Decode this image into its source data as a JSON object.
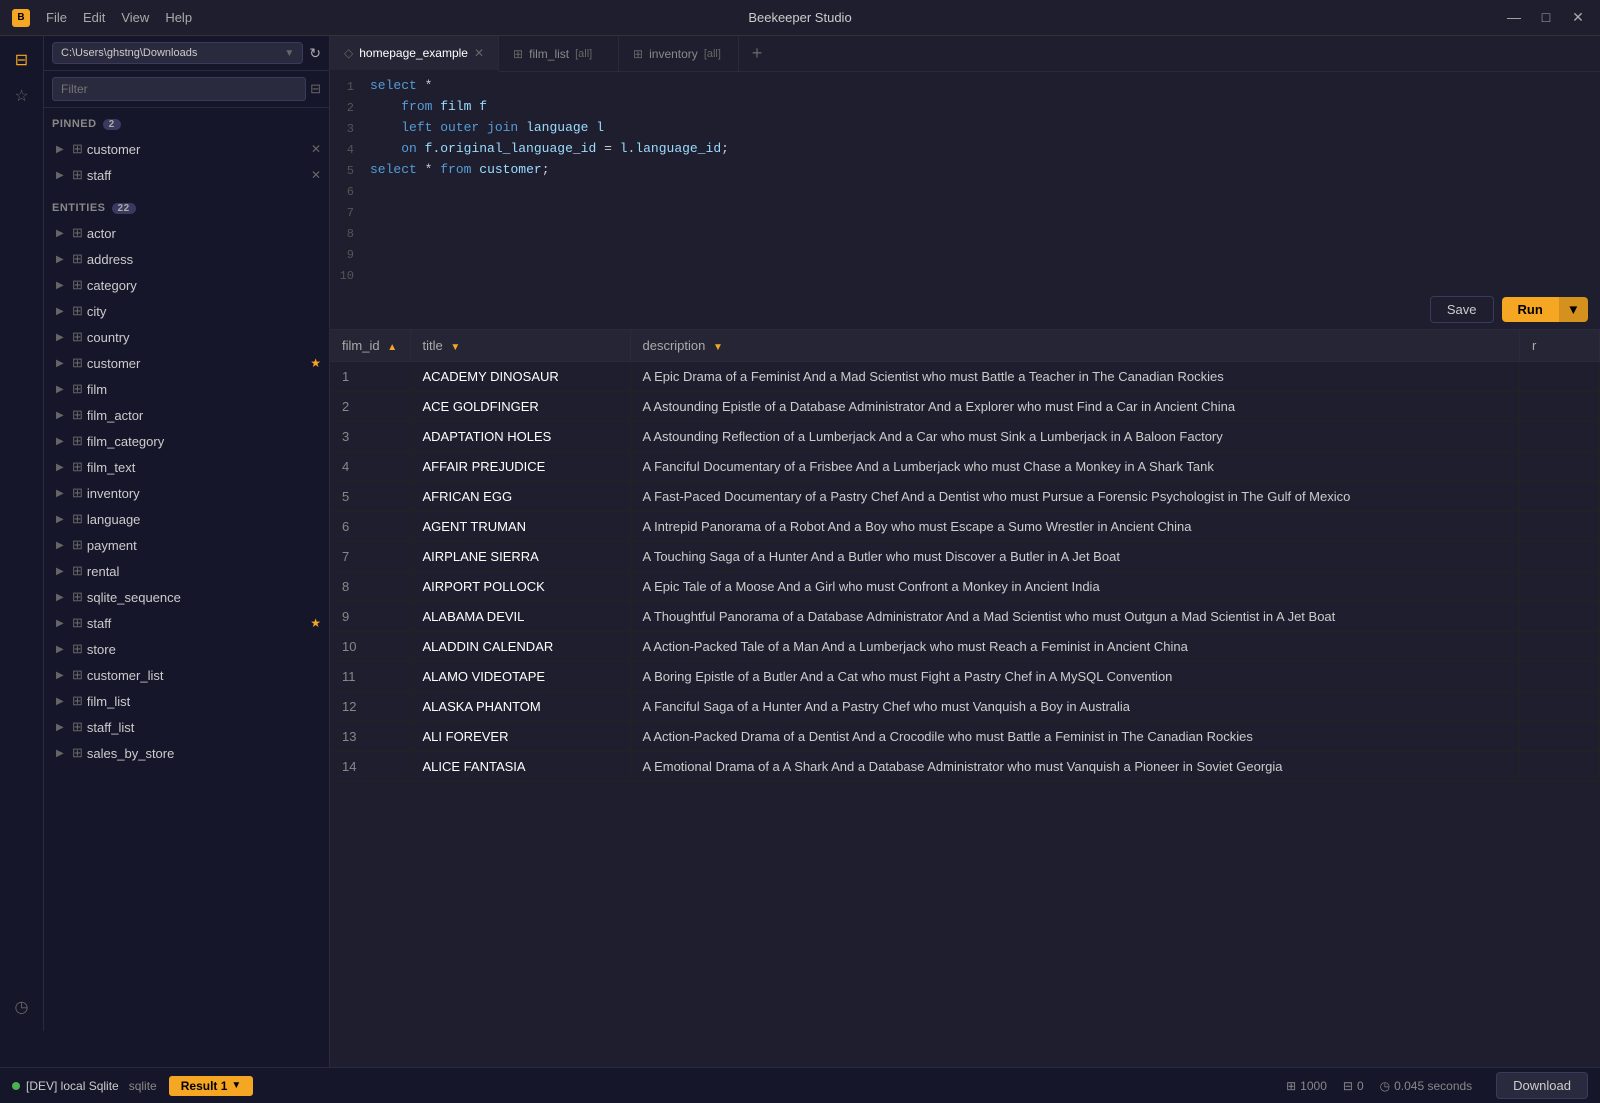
{
  "app": {
    "title": "Beekeeper Studio",
    "icon": "B"
  },
  "titlebar": {
    "menus": [
      "File",
      "Edit",
      "View",
      "Help"
    ],
    "controls": [
      "—",
      "□",
      "✕"
    ]
  },
  "sidebar": {
    "db_path": "C:\\Users\\ghstng\\Downloads",
    "filter_placeholder": "Filter",
    "pinned_section": "PINNED",
    "pinned_count": "2",
    "entities_section": "ENTITIES",
    "entities_count": "22",
    "pinned_items": [
      {
        "name": "customer",
        "pinned": false,
        "has_close": true
      },
      {
        "name": "staff",
        "pinned": false,
        "has_close": true
      }
    ],
    "entities": [
      {
        "name": "actor"
      },
      {
        "name": "address"
      },
      {
        "name": "category"
      },
      {
        "name": "city"
      },
      {
        "name": "country"
      },
      {
        "name": "customer",
        "starred": true
      },
      {
        "name": "film"
      },
      {
        "name": "film_actor"
      },
      {
        "name": "film_category"
      },
      {
        "name": "film_text"
      },
      {
        "name": "inventory"
      },
      {
        "name": "language"
      },
      {
        "name": "payment"
      },
      {
        "name": "rental"
      },
      {
        "name": "sqlite_sequence"
      },
      {
        "name": "staff",
        "starred": true
      },
      {
        "name": "store"
      },
      {
        "name": "customer_list"
      },
      {
        "name": "film_list"
      },
      {
        "name": "staff_list"
      },
      {
        "name": "sales_by_store"
      }
    ]
  },
  "tabs": [
    {
      "id": "homepage_example",
      "label": "homepage_example",
      "icon": "◇",
      "active": true,
      "closable": true
    },
    {
      "id": "film_list",
      "label": "film_list",
      "suffix": "[all]",
      "icon": "⊞",
      "active": false,
      "closable": false
    },
    {
      "id": "inventory",
      "label": "inventory",
      "suffix": "[all]",
      "icon": "⊞",
      "active": false,
      "closable": false
    }
  ],
  "editor": {
    "lines": [
      {
        "num": 1,
        "content": "select *"
      },
      {
        "num": 2,
        "content": "    from film f"
      },
      {
        "num": 3,
        "content": "    left outer join language l"
      },
      {
        "num": 4,
        "content": "    on f.original_language_id = l.language_id;"
      },
      {
        "num": 5,
        "content": "select * from customer;"
      },
      {
        "num": 6,
        "content": ""
      },
      {
        "num": 7,
        "content": ""
      },
      {
        "num": 8,
        "content": ""
      },
      {
        "num": 9,
        "content": ""
      },
      {
        "num": 10,
        "content": ""
      }
    ]
  },
  "toolbar": {
    "save_label": "Save",
    "run_label": "Run"
  },
  "table": {
    "columns": [
      {
        "id": "film_id",
        "label": "film_id",
        "sortable": true,
        "sort": "asc"
      },
      {
        "id": "title",
        "label": "title",
        "sortable": true,
        "sort": "desc"
      },
      {
        "id": "description",
        "label": "description",
        "sortable": true,
        "sort": "desc"
      },
      {
        "id": "extra",
        "label": "r",
        "sortable": false
      }
    ],
    "rows": [
      {
        "film_id": "1",
        "title": "ACADEMY DINOSAUR",
        "description": "A Epic Drama of a Feminist And a Mad Scientist who must Battle a Teacher in The Canadian Rockies"
      },
      {
        "film_id": "2",
        "title": "ACE GOLDFINGER",
        "description": "A Astounding Epistle of a Database Administrator And a Explorer who must Find a Car in Ancient China"
      },
      {
        "film_id": "3",
        "title": "ADAPTATION HOLES",
        "description": "A Astounding Reflection of a Lumberjack And a Car who must Sink a Lumberjack in A Baloon Factory"
      },
      {
        "film_id": "4",
        "title": "AFFAIR PREJUDICE",
        "description": "A Fanciful Documentary of a Frisbee And a Lumberjack who must Chase a Monkey in A Shark Tank"
      },
      {
        "film_id": "5",
        "title": "AFRICAN EGG",
        "description": "A Fast-Paced Documentary of a Pastry Chef And a Dentist who must Pursue a Forensic Psychologist in The Gulf of Mexico"
      },
      {
        "film_id": "6",
        "title": "AGENT TRUMAN",
        "description": "A Intrepid Panorama of a Robot And a Boy who must Escape a Sumo Wrestler in Ancient China"
      },
      {
        "film_id": "7",
        "title": "AIRPLANE SIERRA",
        "description": "A Touching Saga of a Hunter And a Butler who must Discover a Butler in A Jet Boat"
      },
      {
        "film_id": "8",
        "title": "AIRPORT POLLOCK",
        "description": "A Epic Tale of a Moose And a Girl who must Confront a Monkey in Ancient India"
      },
      {
        "film_id": "9",
        "title": "ALABAMA DEVIL",
        "description": "A Thoughtful Panorama of a Database Administrator And a Mad Scientist who must Outgun a Mad Scientist in A Jet Boat"
      },
      {
        "film_id": "10",
        "title": "ALADDIN CALENDAR",
        "description": "A Action-Packed Tale of a Man And a Lumberjack who must Reach a Feminist in Ancient China"
      },
      {
        "film_id": "11",
        "title": "ALAMO VIDEOTAPE",
        "description": "A Boring Epistle of a Butler And a Cat who must Fight a Pastry Chef in A MySQL Convention"
      },
      {
        "film_id": "12",
        "title": "ALASKA PHANTOM",
        "description": "A Fanciful Saga of a Hunter And a Pastry Chef who must Vanquish a Boy in Australia"
      },
      {
        "film_id": "13",
        "title": "ALI FOREVER",
        "description": "A Action-Packed Drama of a Dentist And a Crocodile who must Battle a Feminist in The Canadian Rockies"
      },
      {
        "film_id": "14",
        "title": "ALICE FANTASIA",
        "description": "A Emotional Drama of a A Shark And a Database Administrator who must Vanquish a Pioneer in Soviet Georgia"
      }
    ]
  },
  "statusbar": {
    "connection_label": "[DEV] local Sqlite",
    "db_type": "sqlite",
    "result_tab": "Result 1",
    "row_count": "1000",
    "filter_count": "0",
    "query_time": "0.045 seconds",
    "download_label": "Download"
  }
}
